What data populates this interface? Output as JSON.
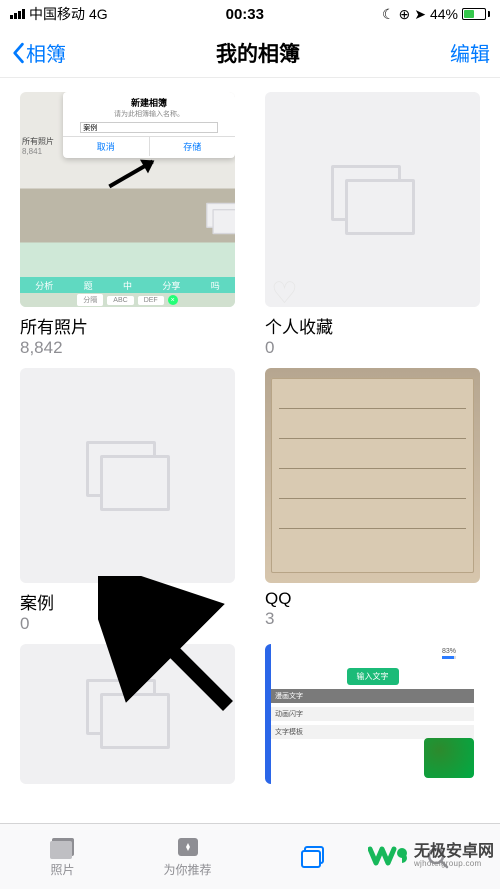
{
  "status": {
    "carrier": "中国移动",
    "network": "4G",
    "time": "00:33",
    "battery_pct": "44%"
  },
  "nav": {
    "back_label": "相簿",
    "title": "我的相簿",
    "edit_label": "编辑"
  },
  "albums": [
    {
      "title": "所有照片",
      "count": "8,842",
      "dialog": {
        "title": "新建相簿",
        "sub": "请为此相簿输入名称。",
        "input": "案例",
        "cancel": "取消",
        "save": "存储"
      },
      "side_label": "所有照片",
      "side_count": "8,841",
      "strip": [
        "分析",
        "题",
        "中",
        "分享",
        "吗"
      ],
      "kbd": [
        "分隔",
        "ABC",
        "DEF"
      ]
    },
    {
      "title": "个人收藏",
      "count": "0"
    },
    {
      "title": "案例",
      "count": "0"
    },
    {
      "title": "QQ",
      "count": "3"
    }
  ],
  "app_thumb": {
    "progress": "83%",
    "btn": "输入文字",
    "rows": [
      "漫画文字",
      "动画闪字",
      "文字模板"
    ]
  },
  "tabs": {
    "photos": "照片",
    "foryou": "为你推荐",
    "albums": "相簿",
    "search": "搜索"
  },
  "watermark": {
    "cn": "无极安卓网",
    "en": "wjhotelgroup.com"
  }
}
